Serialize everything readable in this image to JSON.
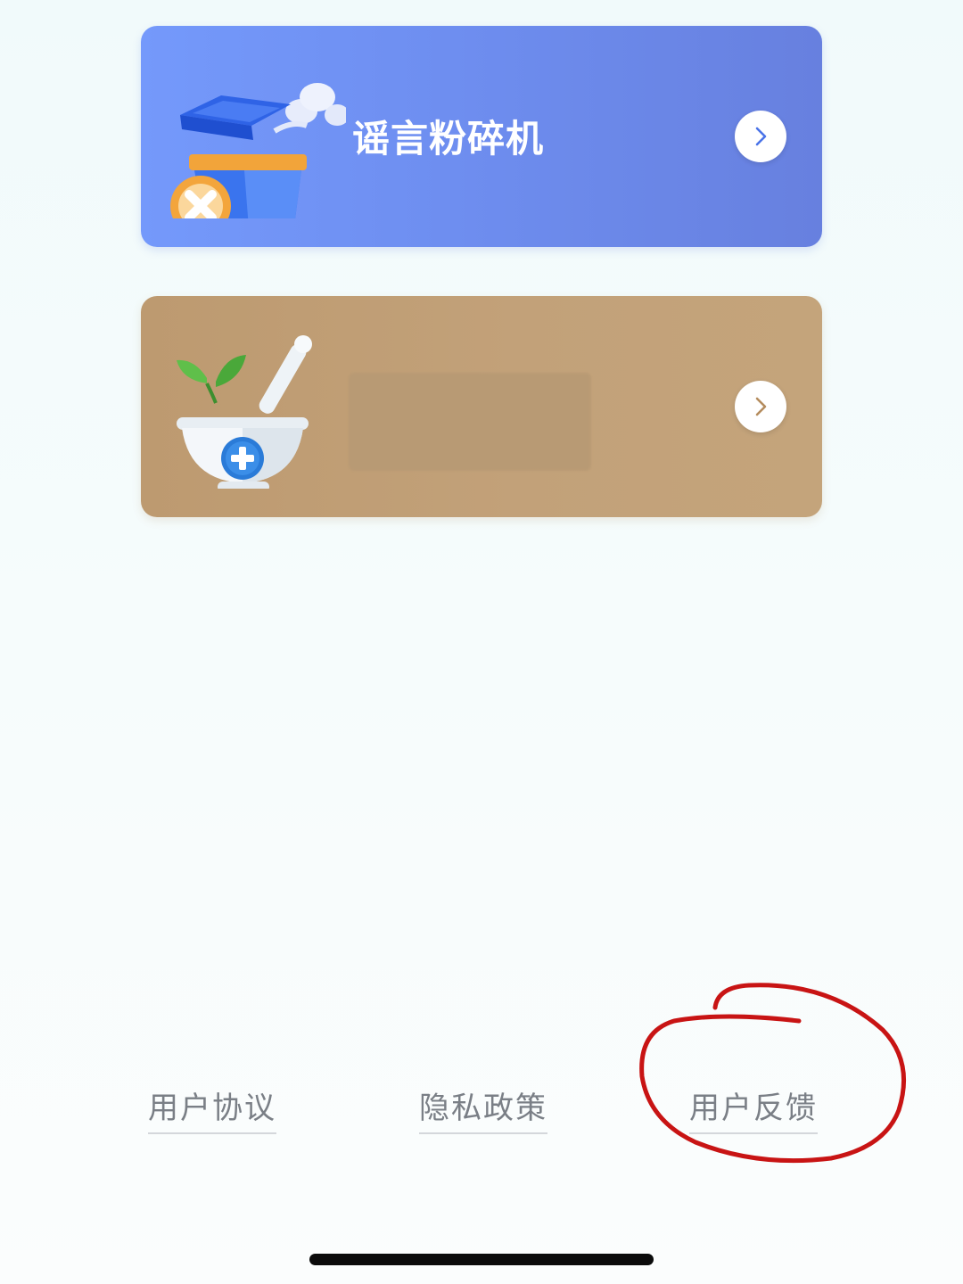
{
  "cards": {
    "rumor_shredder": {
      "title": "谣言粉碎机",
      "icon": "trash-bin-icon",
      "arrow_icon": "chevron-right-icon",
      "color": "#6e8ef0"
    },
    "herbal": {
      "title": "",
      "icon": "mortar-pestle-icon",
      "arrow_icon": "chevron-right-icon",
      "color": "#c2a179"
    }
  },
  "footer": {
    "user_agreement": "用户协议",
    "privacy_policy": "隐私政策",
    "user_feedback": "用户反馈"
  },
  "annotation": {
    "shape": "hand-drawn-circle",
    "color": "#c81414",
    "target": "user_feedback"
  },
  "colors": {
    "background": "#f4fbfb",
    "footer_text": "#7a7f86",
    "rumor_card": "#6e8ef0",
    "herbal_card": "#c2a179"
  }
}
